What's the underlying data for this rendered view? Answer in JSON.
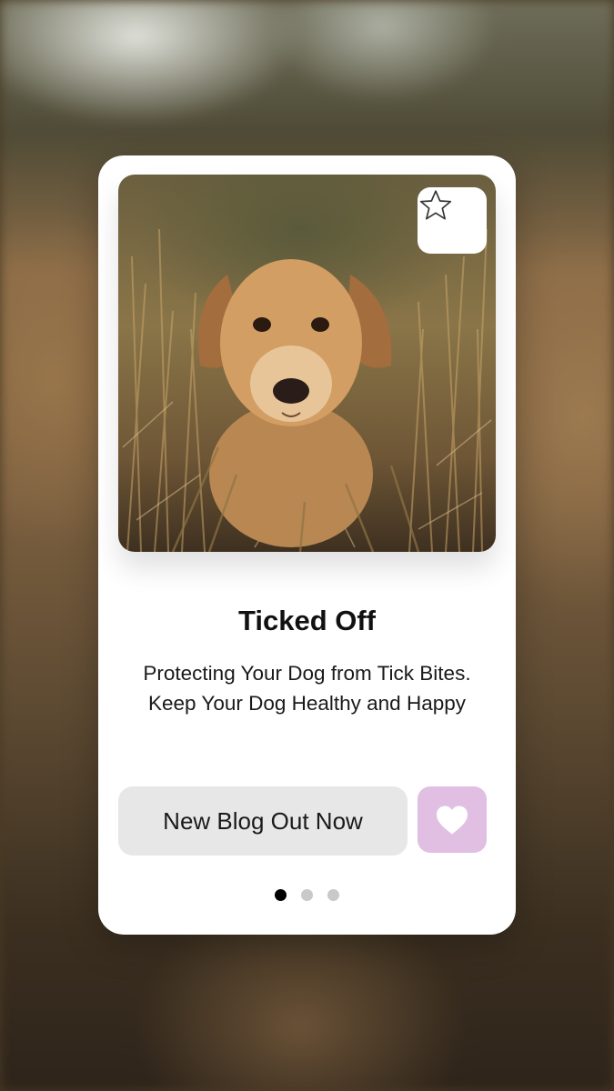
{
  "card": {
    "title": "Ticked Off",
    "subtitle_lines": [
      "Protecting Your Dog from Tick Bites.",
      "Keep Your Dog Healthy and Happy"
    ],
    "cta_label": "New Blog Out Now",
    "favorite_icon": "star-outline-icon",
    "like_icon": "heart-icon",
    "like_color": "#e0bfe2",
    "image_subject": "golden-retriever-in-tall-grass",
    "pagination": {
      "total": 3,
      "active": 1
    }
  }
}
